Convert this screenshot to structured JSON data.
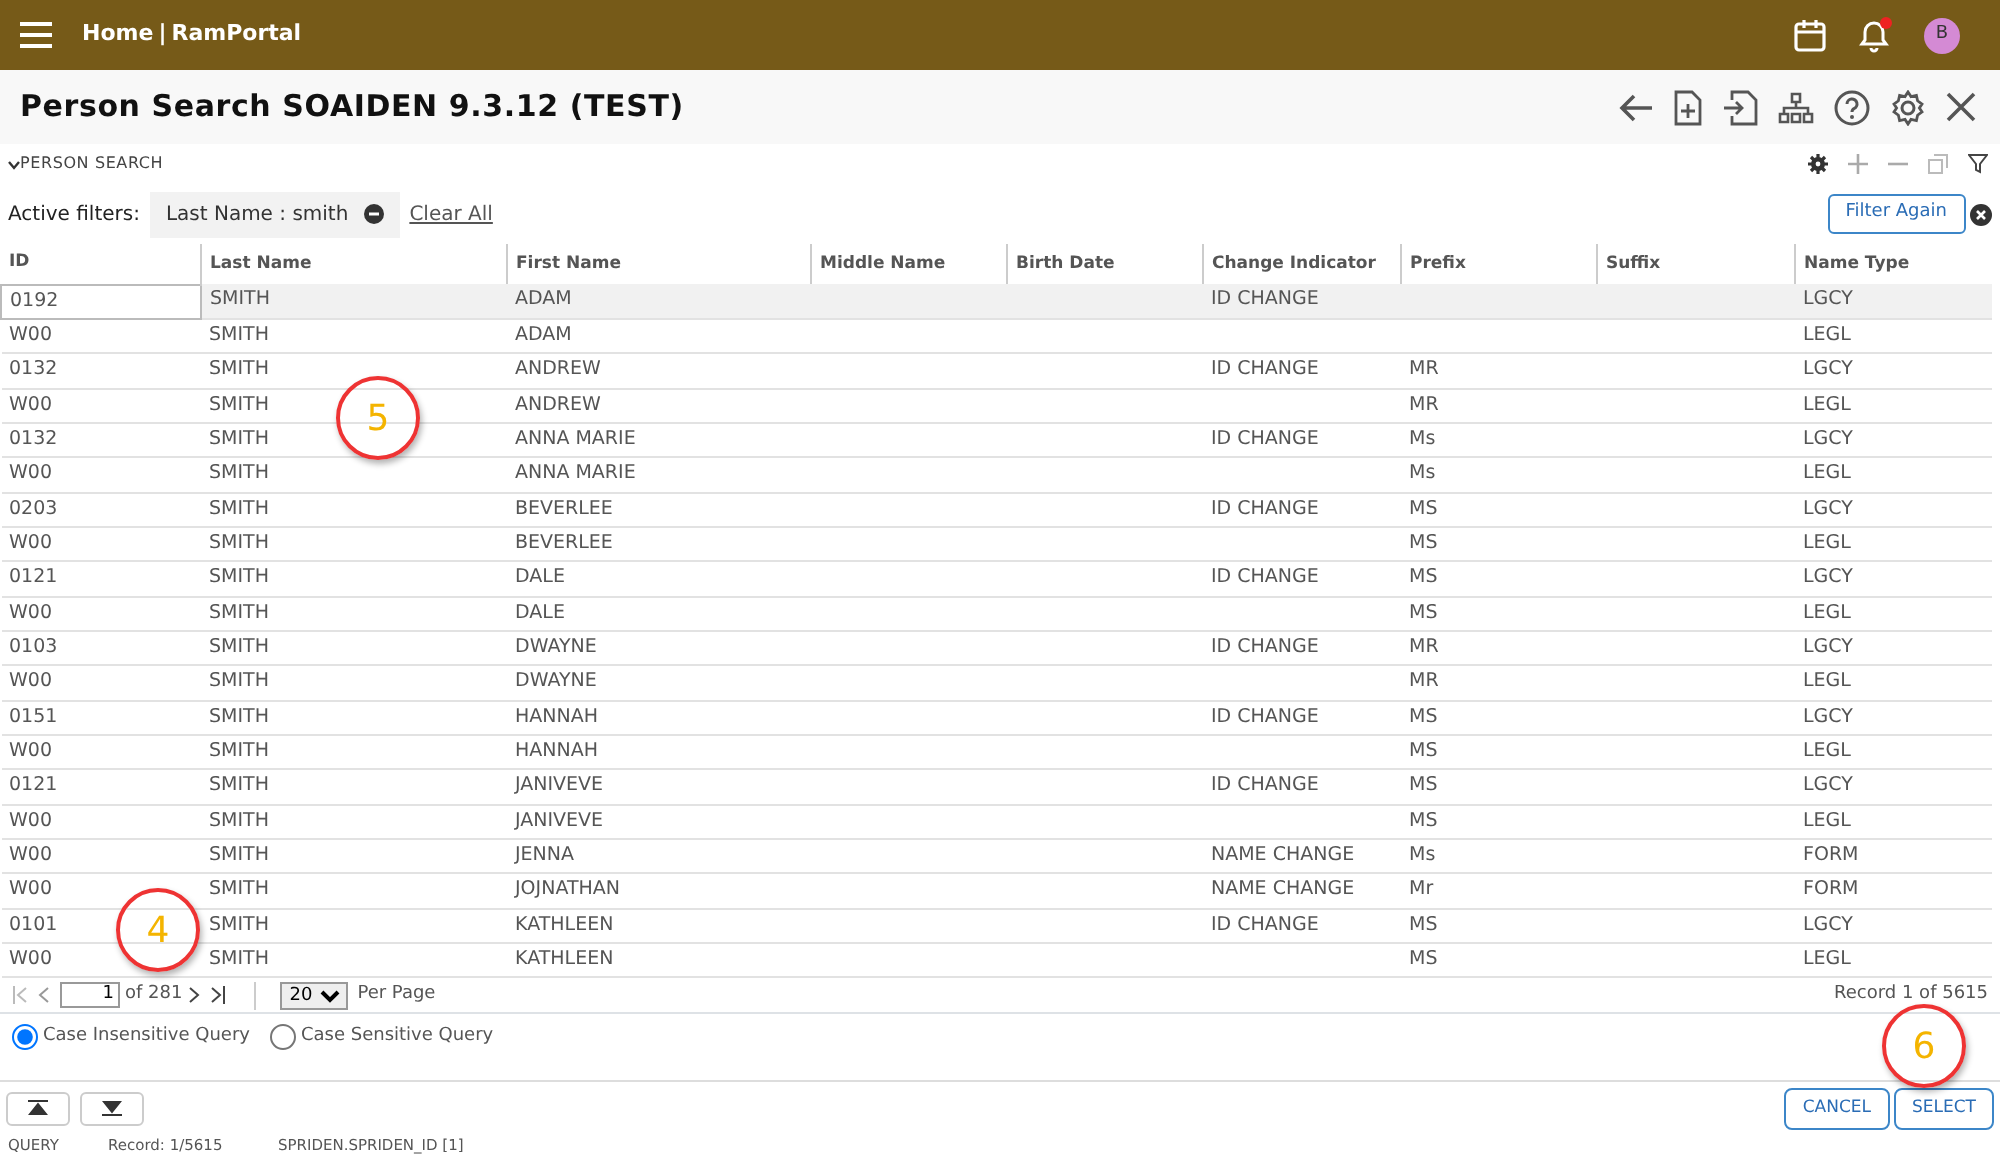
{
  "top_bar": {
    "breadcrumb": [
      "Home",
      "RamPortal"
    ],
    "separator": "|",
    "notification_unread": true,
    "avatar_initial": "B"
  },
  "page_title": "Person Search SOAIDEN 9.3.12 (TEST)",
  "section": {
    "title": "PERSON SEARCH",
    "expanded": true
  },
  "filters": {
    "label": "Active filters:",
    "chips": [
      {
        "field": "Last Name :",
        "value": "smith"
      }
    ],
    "clear_all": "Clear All",
    "filter_again": "Filter Again"
  },
  "table": {
    "columns": [
      "ID",
      "Last Name",
      "First Name",
      "Middle Name",
      "Birth Date",
      "Change Indicator",
      "Prefix",
      "Suffix",
      "Name Type"
    ],
    "rows": [
      {
        "selected": true,
        "cells": [
          "0192",
          "SMITH",
          "ADAM",
          "",
          "",
          "ID CHANGE",
          "",
          "",
          "LGCY"
        ]
      },
      {
        "selected": false,
        "cells": [
          "W00",
          "SMITH",
          "ADAM",
          "",
          "",
          "",
          "",
          "",
          "LEGL"
        ]
      },
      {
        "selected": false,
        "cells": [
          "0132",
          "SMITH",
          "ANDREW",
          "",
          "",
          "ID CHANGE",
          "MR",
          "",
          "LGCY"
        ]
      },
      {
        "selected": false,
        "cells": [
          "W00",
          "SMITH",
          "ANDREW",
          "",
          "",
          "",
          "MR",
          "",
          "LEGL"
        ]
      },
      {
        "selected": false,
        "cells": [
          "0132",
          "SMITH",
          "ANNA MARIE",
          "",
          "",
          "ID CHANGE",
          "Ms",
          "",
          "LGCY"
        ]
      },
      {
        "selected": false,
        "cells": [
          "W00",
          "SMITH",
          "ANNA MARIE",
          "",
          "",
          "",
          "Ms",
          "",
          "LEGL"
        ]
      },
      {
        "selected": false,
        "cells": [
          "0203",
          "SMITH",
          "BEVERLEE",
          "",
          "",
          "ID CHANGE",
          "MS",
          "",
          "LGCY"
        ]
      },
      {
        "selected": false,
        "cells": [
          "W00",
          "SMITH",
          "BEVERLEE",
          "",
          "",
          "",
          "MS",
          "",
          "LEGL"
        ]
      },
      {
        "selected": false,
        "cells": [
          "0121",
          "SMITH",
          "DALE",
          "",
          "",
          "ID CHANGE",
          "MS",
          "",
          "LGCY"
        ]
      },
      {
        "selected": false,
        "cells": [
          "W00",
          "SMITH",
          "DALE",
          "",
          "",
          "",
          "MS",
          "",
          "LEGL"
        ]
      },
      {
        "selected": false,
        "cells": [
          "0103",
          "SMITH",
          "DWAYNE",
          "",
          "",
          "ID CHANGE",
          "MR",
          "",
          "LGCY"
        ]
      },
      {
        "selected": false,
        "cells": [
          "W00",
          "SMITH",
          "DWAYNE",
          "",
          "",
          "",
          "MR",
          "",
          "LEGL"
        ]
      },
      {
        "selected": false,
        "cells": [
          "0151",
          "SMITH",
          "HANNAH",
          "",
          "",
          "ID CHANGE",
          "MS",
          "",
          "LGCY"
        ]
      },
      {
        "selected": false,
        "cells": [
          "W00",
          "SMITH",
          "HANNAH",
          "",
          "",
          "",
          "MS",
          "",
          "LEGL"
        ]
      },
      {
        "selected": false,
        "cells": [
          "0121",
          "SMITH",
          "JANIVEVE",
          "",
          "",
          "ID CHANGE",
          "MS",
          "",
          "LGCY"
        ]
      },
      {
        "selected": false,
        "cells": [
          "W00",
          "SMITH",
          "JANIVEVE",
          "",
          "",
          "",
          "MS",
          "",
          "LEGL"
        ]
      },
      {
        "selected": false,
        "cells": [
          "W00",
          "SMITH",
          "JENNA",
          "",
          "",
          "NAME CHANGE",
          "Ms",
          "",
          "FORM"
        ]
      },
      {
        "selected": false,
        "cells": [
          "W00",
          "SMITH",
          "JOJNATHAN",
          "",
          "",
          "NAME CHANGE",
          "Mr",
          "",
          "FORM"
        ]
      },
      {
        "selected": false,
        "cells": [
          "0101",
          "SMITH",
          "KATHLEEN",
          "",
          "",
          "ID CHANGE",
          "MS",
          "",
          "LGCY"
        ]
      },
      {
        "selected": false,
        "cells": [
          "W00",
          "SMITH",
          "KATHLEEN",
          "",
          "",
          "",
          "MS",
          "",
          "LEGL"
        ]
      }
    ]
  },
  "pager": {
    "page": "1",
    "of_pages": "of 281",
    "per_page": "20",
    "per_page_label": "Per Page",
    "record_info": "Record 1 of 5615"
  },
  "query_options": [
    {
      "label": "Case Insensitive Query",
      "selected": true
    },
    {
      "label": "Case Sensitive Query",
      "selected": false
    }
  ],
  "buttons": [
    "CANCEL",
    "SELECT"
  ],
  "status_bar": [
    "QUERY",
    "Record: 1/5615",
    "SPRIDEN.SPRIDEN_ID [1]"
  ],
  "annotations": [
    {
      "label": "5"
    },
    {
      "label": "4"
    },
    {
      "label": "6"
    }
  ]
}
